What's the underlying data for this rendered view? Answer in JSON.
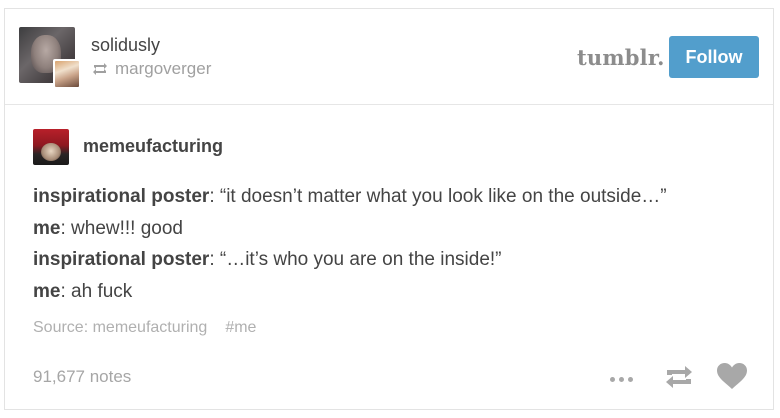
{
  "post": {
    "username": "solidusly",
    "reblogged_from": "margoverger",
    "logo_text": "tumblr.",
    "follow_label": "Follow",
    "source_blog": "memeufacturing",
    "lines": [
      {
        "speaker": "inspirational poster",
        "sep": ":",
        "text": " “it doesn’t matter what you look like on the outside…”"
      },
      {
        "speaker": "me",
        "sep": ":",
        "text": " whew!!! good"
      },
      {
        "speaker": "inspirational poster",
        "sep": ":",
        "text": " “…it’s who you are on the inside!”"
      },
      {
        "speaker": "me",
        "sep": ":",
        "text": " ah fuck"
      }
    ],
    "source_label": "Source: memeufacturing",
    "tag": "#me",
    "notes": "91,677 notes"
  },
  "colors": {
    "follow_button": "#529ecc",
    "muted_text": "#a6a6a6",
    "body_text": "#444444"
  },
  "icons": {
    "reblog_small": "reblog-icon",
    "more": "more-dots-icon",
    "reblog": "reblog-icon",
    "like": "heart-icon"
  }
}
